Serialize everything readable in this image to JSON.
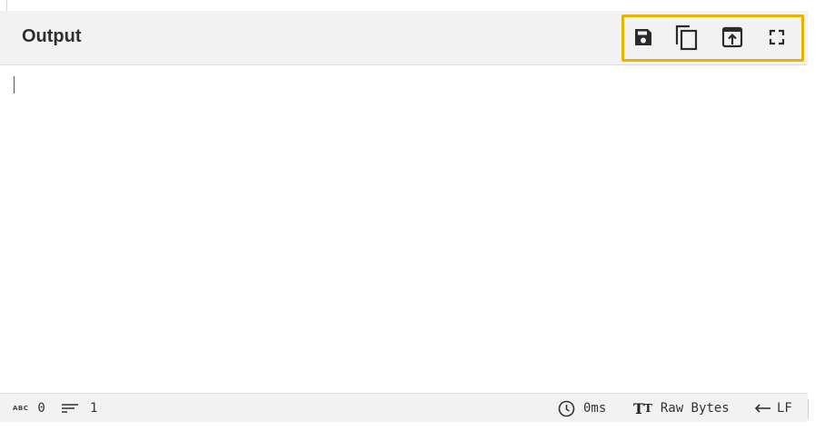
{
  "header": {
    "title": "Output",
    "highlight_color": "#e6b400",
    "buttons": [
      {
        "name": "save-button",
        "icon": "save-icon"
      },
      {
        "name": "copy-button",
        "icon": "copy-icon"
      },
      {
        "name": "replace-input-button",
        "icon": "open-in-box-icon"
      },
      {
        "name": "maximise-button",
        "icon": "fullscreen-icon"
      }
    ]
  },
  "editor": {
    "value": ""
  },
  "statusbar": {
    "length_value": "0",
    "lines_value": "1",
    "time_value": "0ms",
    "encoding_label": "Raw Bytes",
    "eol_label": "LF",
    "abc_label": "ABC"
  }
}
